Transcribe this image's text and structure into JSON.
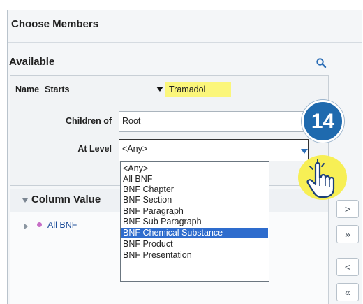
{
  "dialog": {
    "title": "Choose Members"
  },
  "available": {
    "heading": "Available",
    "name_label": "Name",
    "name_operator": "Starts",
    "name_value": "Tramadol",
    "children_of_label": "Children of",
    "children_of_value": "Root",
    "at_level_label": "At Level",
    "at_level_value": "<Any>",
    "level_options": [
      "<Any>",
      "All BNF",
      "BNF Chapter",
      "BNF Section",
      "BNF Paragraph",
      "BNF Sub Paragraph",
      "BNF Chemical Substance",
      "BNF Product",
      "BNF Presentation"
    ],
    "highlighted_option": "BNF Chemical Substance"
  },
  "column_values": {
    "heading": "Column Value",
    "tree_item": "All BNF"
  },
  "move_buttons": [
    ">",
    "»",
    "<",
    "«"
  ],
  "callout": {
    "step_number": "14"
  },
  "colors": {
    "badge": "#1f6aae",
    "highlight": "#fbf67b",
    "selected_option": "#2e6ccd"
  }
}
